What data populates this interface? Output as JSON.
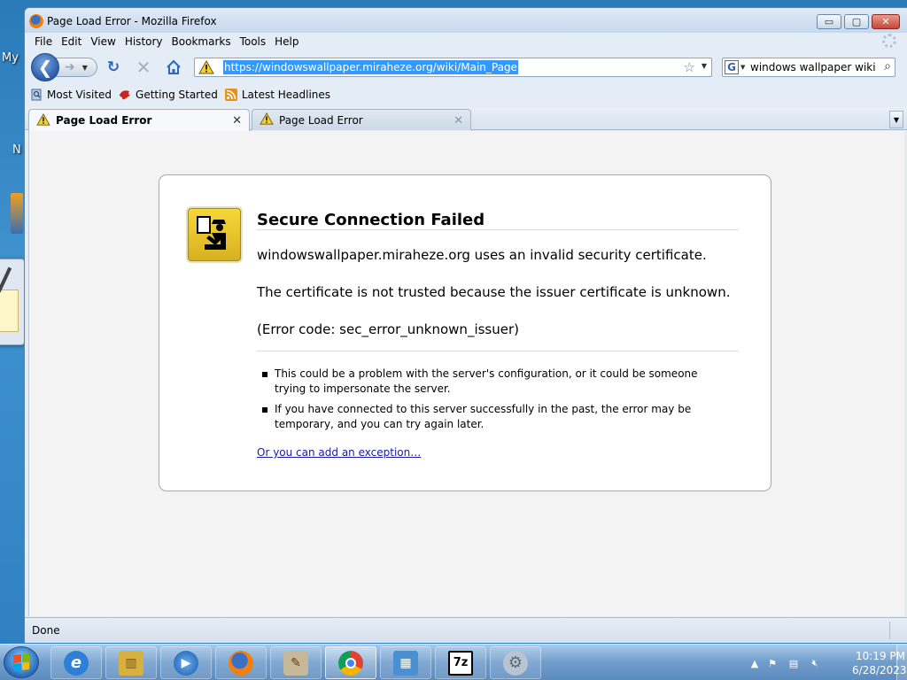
{
  "desktop": {
    "label_fragment": "My",
    "letter_fragment": "N"
  },
  "window": {
    "title": "Page Load Error - Mozilla Firefox",
    "controls": {
      "minimize": "▭",
      "maximize": "▢",
      "close": "✕"
    }
  },
  "menu": [
    {
      "underline": "F",
      "rest": "ile"
    },
    {
      "underline": "E",
      "rest": "dit"
    },
    {
      "underline": "V",
      "rest": "iew"
    },
    {
      "underline": "Hi",
      "rest": "story",
      "pre": ""
    },
    {
      "underline": "B",
      "rest": "ookmarks"
    },
    {
      "underline": "T",
      "rest": "ools"
    },
    {
      "underline": "H",
      "rest": "elp"
    }
  ],
  "menu_labels": [
    "File",
    "Edit",
    "View",
    "History",
    "Bookmarks",
    "Tools",
    "Help"
  ],
  "navigation": {
    "url": "https://windowswallpaper.miraheze.org/wiki/Main_Page",
    "search_query": "windows wallpaper wiki",
    "search_engine": "G"
  },
  "bookmarks": [
    {
      "label": "Most Visited",
      "icon": "bookmarks-icon"
    },
    {
      "label": "Getting Started",
      "icon": "firefox-getting-started-icon"
    },
    {
      "label": "Latest Headlines",
      "icon": "rss-feed-icon"
    }
  ],
  "tabs": [
    {
      "label": "Page Load Error",
      "active": true,
      "icon": "warning-icon"
    },
    {
      "label": "Page Load Error",
      "active": false,
      "icon": "warning-icon"
    }
  ],
  "error": {
    "title": "Secure Connection Failed",
    "message1": "windowswallpaper.miraheze.org uses an invalid security certificate.",
    "message2": "The certificate is not trusted because the issuer certificate is unknown.",
    "message3": "(Error code: sec_error_unknown_issuer)",
    "bullets": [
      "This could be a problem with the server's configuration, or it could be someone trying to impersonate the server.",
      "If you have connected to this server successfully in the past, the error may be temporary, and you can try again later."
    ],
    "exception_link": "Or you can add an exception…"
  },
  "status": {
    "text": "Done"
  },
  "taskbar": {
    "apps": [
      {
        "name": "internet-explorer",
        "icon": "ie-icon",
        "glyph": "e",
        "color": "#2d7fd8"
      },
      {
        "name": "windows-explorer",
        "icon": "folder-icon",
        "glyph": "▥",
        "color": "#d8b040"
      },
      {
        "name": "media-player",
        "icon": "media-player-icon",
        "glyph": "▶",
        "color": "#2a70c8"
      },
      {
        "name": "firefox",
        "icon": "firefox-icon",
        "glyph": "◉",
        "color": "#e06a1a"
      },
      {
        "name": "paint-brushes",
        "icon": "brushes-icon",
        "glyph": "✎",
        "color": "#b89060"
      },
      {
        "name": "chrome",
        "icon": "chrome-icon",
        "glyph": "◎",
        "color": "#d83a2a"
      },
      {
        "name": "remote-desktop",
        "icon": "network-icon",
        "glyph": "▦",
        "color": "#4a90d0"
      },
      {
        "name": "7zip",
        "icon": "7zip-icon",
        "glyph": "7z",
        "color": "#1a1a1a"
      },
      {
        "name": "settings-tool",
        "icon": "gear-icon",
        "glyph": "⚙",
        "color": "#9aa8b8"
      }
    ],
    "clock_time": "10:19 PM",
    "clock_date": "6/28/2023"
  },
  "colors": {
    "url_selection": "#3399ff",
    "link": "#1a1aa6",
    "error_icon": "#e8c430"
  }
}
